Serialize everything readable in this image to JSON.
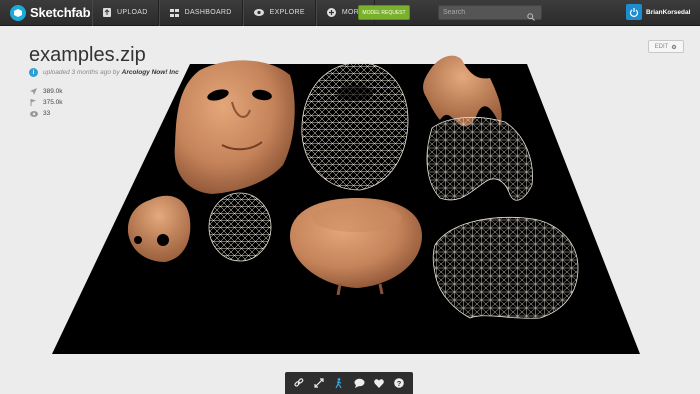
{
  "brand": {
    "name": "Sketchfab"
  },
  "nav": {
    "upload": "UPLOAD",
    "dashboard": "DASHBOARD",
    "explore": "EXPLORE",
    "more": "MORE",
    "model_request": "MODEL REQUEST",
    "search_placeholder": "Search"
  },
  "user": {
    "name": "BrianKorsedal"
  },
  "model": {
    "title": "examples.zip",
    "uploaded": "uploaded 3 months ago by",
    "author": "Arcology Now! Inc",
    "edit_label": "EDIT"
  },
  "stats": {
    "views": "389.0k",
    "downloads": "375.0k",
    "watch": "33"
  },
  "toolbar": {
    "items": [
      "link-icon",
      "fullscreen-icon",
      "walk-icon",
      "comment-icon",
      "heart-icon",
      "help-icon"
    ]
  },
  "colors": {
    "topbar": "#333333",
    "accent_green": "#7ab02c",
    "accent_blue": "#1caad9",
    "stage": "#000000",
    "skin": "#c98a60",
    "wire": "#e8e2d6"
  }
}
